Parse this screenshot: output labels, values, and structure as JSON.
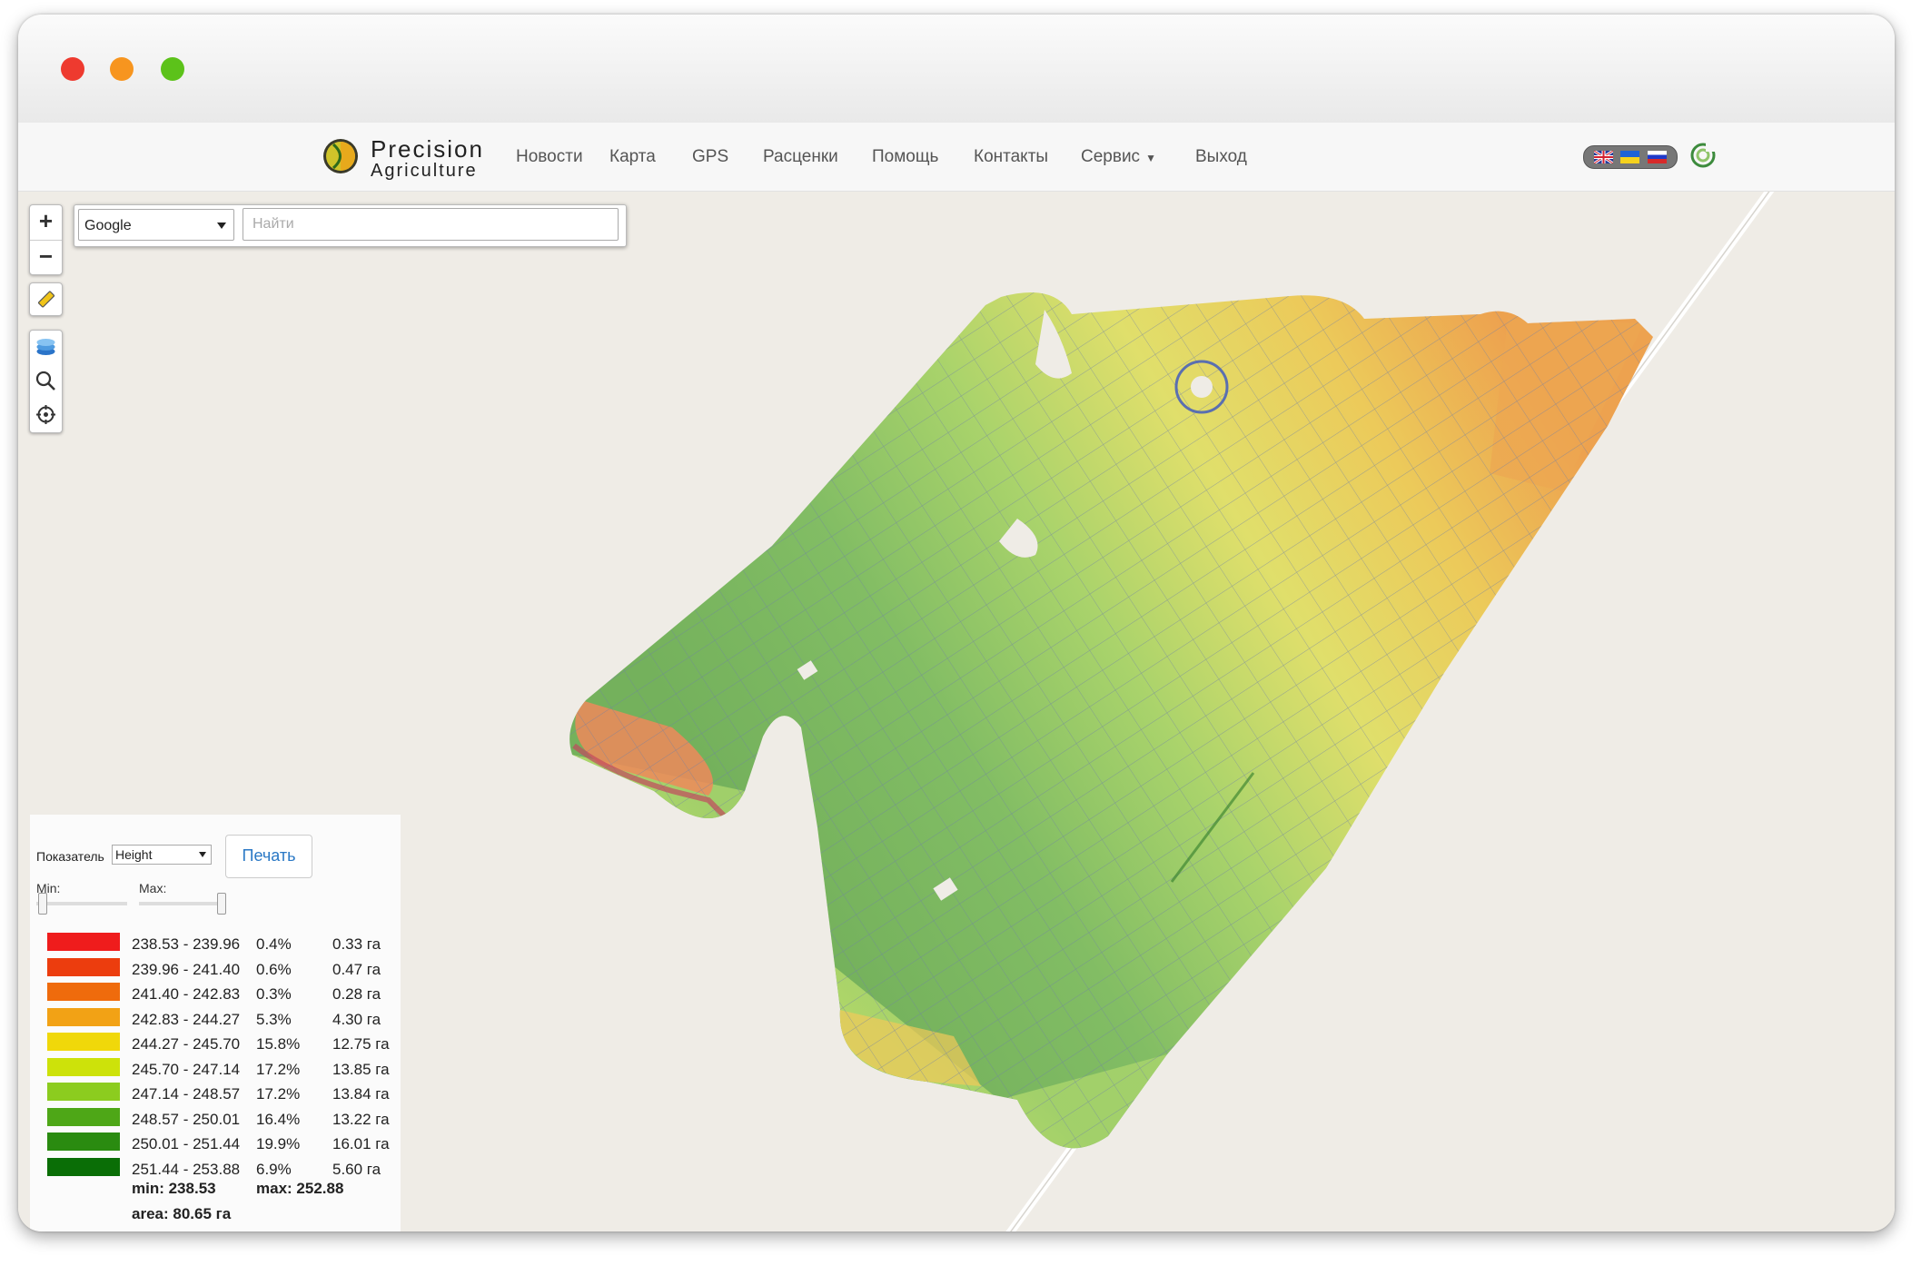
{
  "window": {
    "controls": [
      "close",
      "minimize",
      "zoom"
    ]
  },
  "brand": {
    "line1": "Precision",
    "line2": "Agriculture"
  },
  "nav": [
    {
      "label": "Новости"
    },
    {
      "label": "Карта"
    },
    {
      "label": "GPS"
    },
    {
      "label": "Расценки"
    },
    {
      "label": "Помощь"
    },
    {
      "label": "Контакты"
    },
    {
      "label": "Сервис",
      "dropdown": true
    },
    {
      "label": "Выход"
    }
  ],
  "languages": [
    "en",
    "ua",
    "ru"
  ],
  "map_controls": {
    "zoom_in": "+",
    "zoom_out": "−",
    "tools": [
      "ruler-icon",
      "layers-icon",
      "search-icon",
      "locate-icon"
    ]
  },
  "search": {
    "provider": "Google",
    "placeholder": "Найти"
  },
  "legend": {
    "indicator_label": "Показатель",
    "indicator_value": "Height",
    "print_label": "Печать",
    "min_label": "Min:",
    "max_label": "Max:",
    "classes": [
      {
        "range": "238.53 - 239.96",
        "percent": "0.4%",
        "area": "0.33 га",
        "color": "#ef1c1c"
      },
      {
        "range": "239.96 - 241.40",
        "percent": "0.6%",
        "area": "0.47 га",
        "color": "#ec3d0e"
      },
      {
        "range": "241.40 - 242.83",
        "percent": "0.3%",
        "area": "0.28 га",
        "color": "#ef6b0c"
      },
      {
        "range": "242.83 - 244.27",
        "percent": "5.3%",
        "area": "4.30 га",
        "color": "#f2a215"
      },
      {
        "range": "244.27 - 245.70",
        "percent": "15.8%",
        "area": "12.75 га",
        "color": "#f0d80a"
      },
      {
        "range": "245.70 - 247.14",
        "percent": "17.2%",
        "area": "13.85 га",
        "color": "#cde20a"
      },
      {
        "range": "247.14 - 248.57",
        "percent": "17.2%",
        "area": "13.84 га",
        "color": "#8ccc1f"
      },
      {
        "range": "248.57 - 250.01",
        "percent": "16.4%",
        "area": "13.22 га",
        "color": "#4ea717"
      },
      {
        "range": "250.01 - 251.44",
        "percent": "19.9%",
        "area": "16.01 га",
        "color": "#2a8b10"
      },
      {
        "range": "251.44 - 253.88",
        "percent": "6.9%",
        "area": "5.60 га",
        "color": "#0a6e06"
      }
    ],
    "min_text": "min: 238.53",
    "max_text": "max: 252.88",
    "area_text": "area: 80.65 га"
  }
}
